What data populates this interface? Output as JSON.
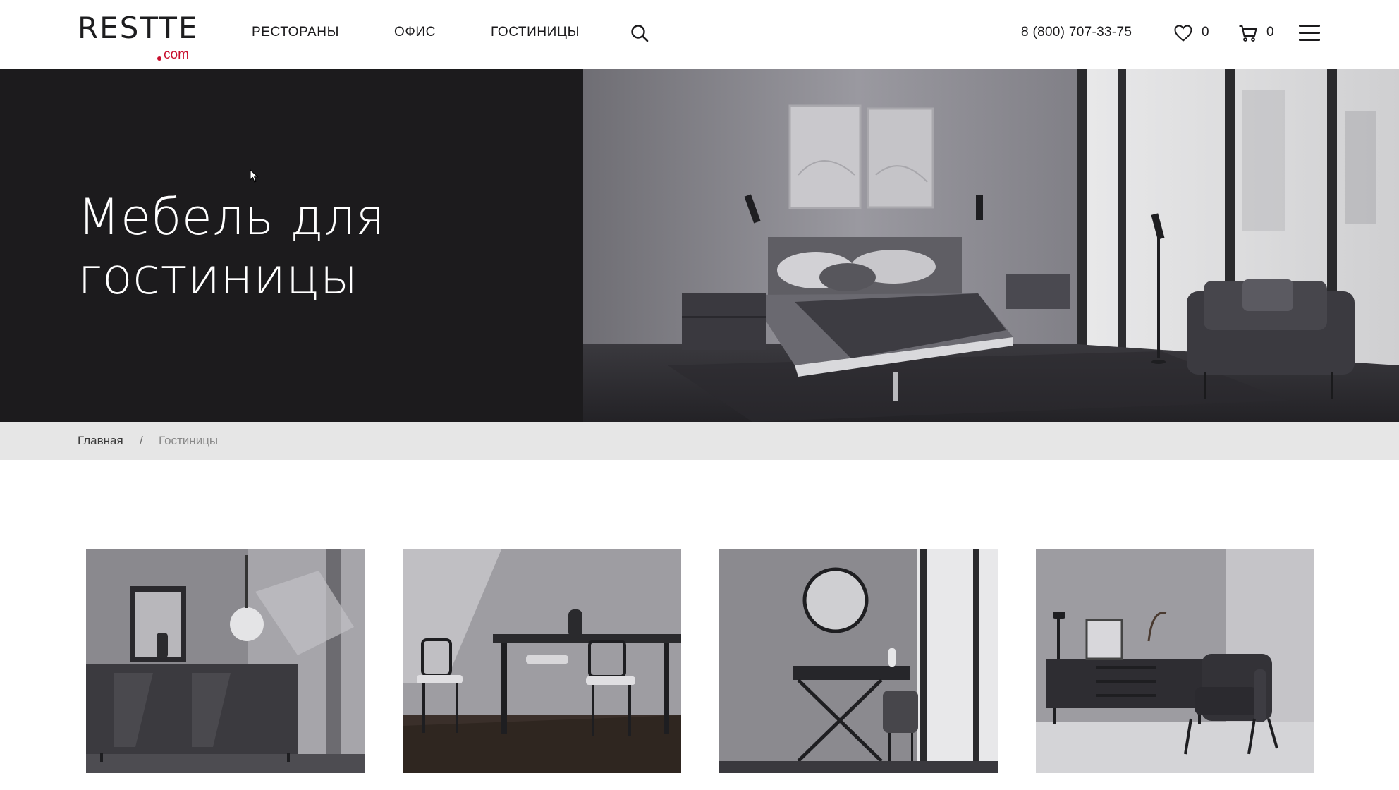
{
  "header": {
    "logo": {
      "word": "RESTTE",
      "suffix": "com"
    },
    "nav": [
      {
        "label": "РЕСТОРАНЫ"
      },
      {
        "label": "ОФИС"
      },
      {
        "label": "ГОСТИНИЦЫ"
      }
    ],
    "search_icon": "search-icon",
    "phone": "8 (800) 707-33-75",
    "favorites": {
      "icon": "heart-icon",
      "count": "0"
    },
    "cart": {
      "icon": "cart-icon",
      "count": "0"
    },
    "menu_icon": "hamburger-icon"
  },
  "hero": {
    "title": "Мебель для гостиницы",
    "image": "bedroom-interior-photo"
  },
  "breadcrumb": {
    "home": "Главная",
    "separator": "/",
    "current": "Гостиницы"
  },
  "products": [
    {
      "image": "sideboard-photo"
    },
    {
      "image": "dining-table-photo"
    },
    {
      "image": "dressing-table-photo"
    },
    {
      "image": "lounge-chair-photo"
    }
  ],
  "colors": {
    "brand_accent": "#c8102e",
    "hero_dark": "#1c1b1d",
    "breadcrumb_bg": "#e6e6e6"
  }
}
